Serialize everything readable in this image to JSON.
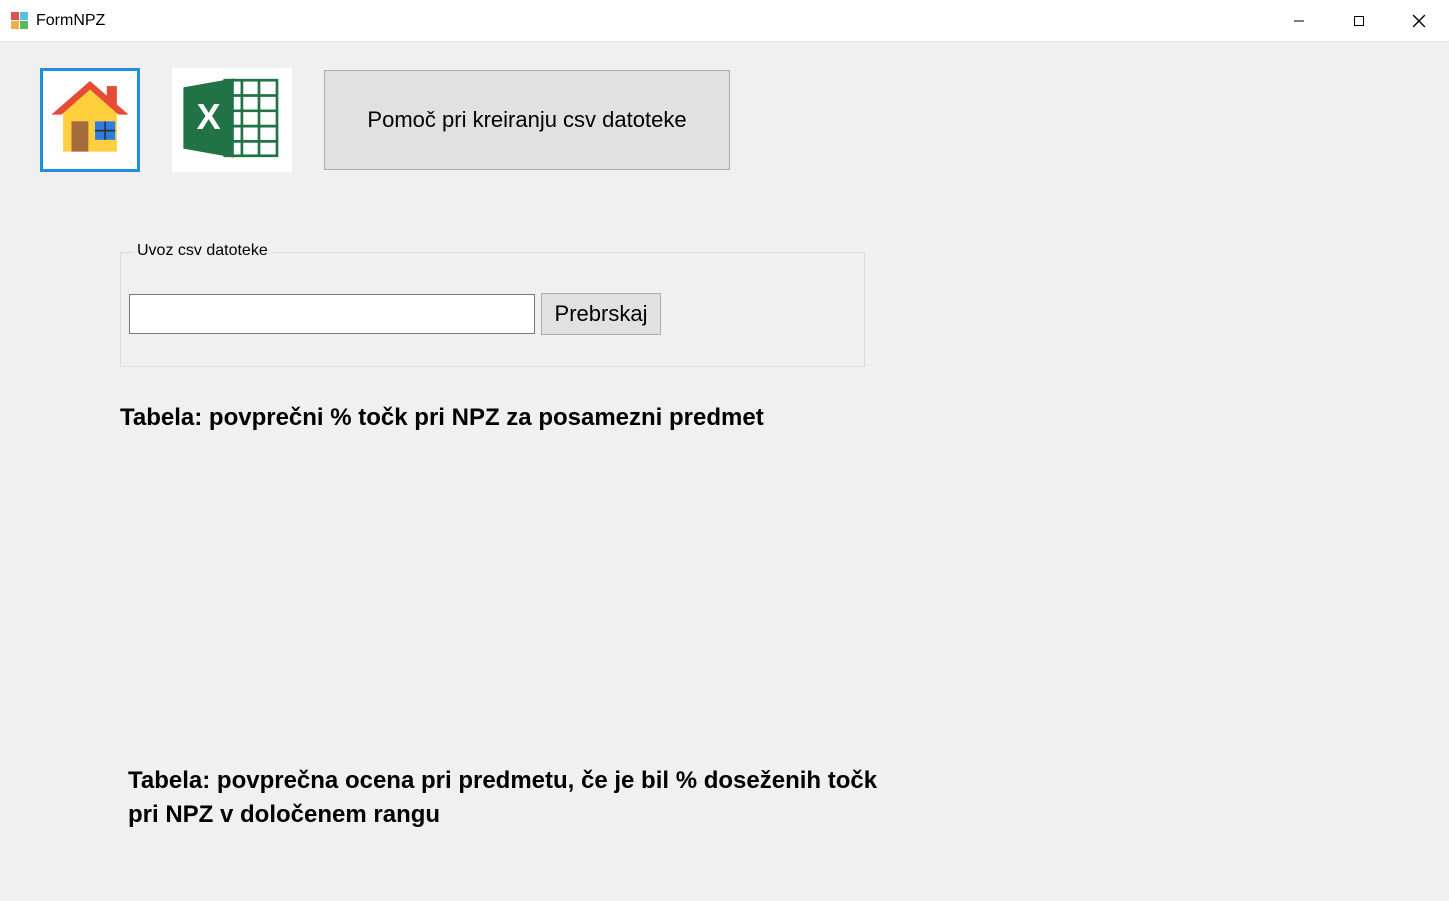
{
  "window": {
    "title": "FormNPZ"
  },
  "toolbar": {
    "help_csv_label": "Pomoč pri kreiranju csv datoteke"
  },
  "import": {
    "groupbox_label": "Uvoz csv datoteke",
    "file_path_value": "",
    "browse_label": "Prebrskaj"
  },
  "headings": {
    "table1": "Tabela: povprečni % točk pri NPZ za posamezni predmet",
    "table2": "Tabela: povprečna ocena pri predmetu, če je bil % doseženih točk pri NPZ v določenem rangu"
  },
  "icons": {
    "home": "home-icon",
    "excel": "excel-icon",
    "app": "forms-app-icon"
  },
  "colors": {
    "client_bg": "#f0f0f0",
    "button_bg": "#e1e1e1",
    "button_border": "#adadad",
    "selection_border": "#1f8fe0",
    "excel_green": "#217346",
    "home_red": "#e64b35",
    "home_yellow": "#ffcf3d"
  }
}
